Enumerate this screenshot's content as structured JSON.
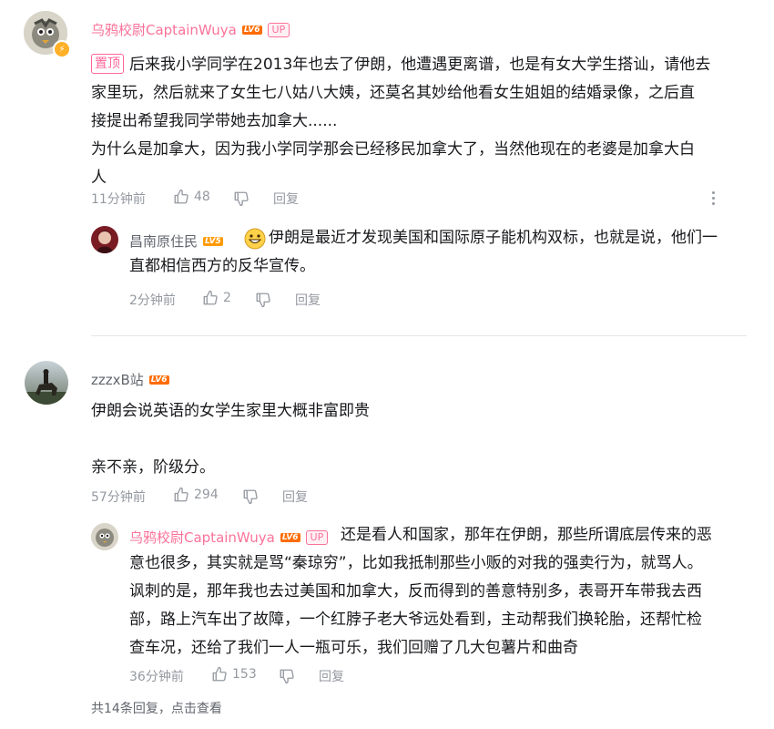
{
  "comments": [
    {
      "user": "乌鸦校尉CaptainWuya",
      "level": "LV6",
      "up_badge": "UP",
      "pinned_label": "置顶",
      "lines": [
        "后来我小学同学在2013年也去了伊朗，他遭遇更离谱，也是有女大学生搭讪，请他去",
        "家里玩，然后就来了女生七八姑八大姨，还莫名其妙给他看女生姐姐的结婚录像，之后直",
        "接提出希望我同学带她去加拿大......",
        "为什么是加拿大，因为我小学同学那会已经移民加拿大了，当然他现在的老婆是加拿大白",
        "人"
      ],
      "time": "11分钟前",
      "likes": "48",
      "reply_label": "回复",
      "reply": {
        "user": "昌南原住民",
        "level": "LV5",
        "lines": [
          "伊朗是最近才发现美国和国际原子能机构双标，也就是说，他们一",
          "直都相信西方的反华宣传。"
        ],
        "time": "2分钟前",
        "likes": "2",
        "reply_label": "回复"
      }
    },
    {
      "user": "zzzxB站",
      "level": "LV6",
      "lines": [
        "伊朗会说英语的女学生家里大概非富即贵",
        "",
        "亲不亲，阶级分。"
      ],
      "time": "57分钟前",
      "likes": "294",
      "reply_label": "回复",
      "reply": {
        "user": "乌鸦校尉CaptainWuya",
        "level": "LV6",
        "up_badge": "UP",
        "lines": [
          "还是看人和国家，那年在伊朗，那些所谓底层传来的恶",
          "意也很多，其实就是骂“秦琼穷”，比如我抵制那些小贩的对我的强卖行为，就骂人。",
          "讽刺的是，那年我也去过美国和加拿大，反而得到的善意特别多，表哥开车带我去西",
          "部，路上汽车出了故障，一个红脖子老大爷远处看到，主动帮我们换轮胎，还帮忙检",
          "查车况，还给了我们一人一瓶可乐，我们回赠了几大包薯片和曲奇"
        ],
        "time": "36分钟前",
        "likes": "153",
        "reply_label": "回复"
      },
      "view_replies": "共14条回复，点击查看"
    }
  ],
  "icons": {
    "like": "thumbs-up-icon",
    "dislike": "thumbs-down-icon",
    "more": "more-vertical-icon",
    "emoji": "emoji-grin-icon",
    "lightning": "lightning-badge-icon"
  },
  "colors": {
    "up_pink": "#fb7299",
    "lv6": "#ff6c00",
    "lv5": "#ff9a00",
    "meta_gray": "#9499a0"
  }
}
